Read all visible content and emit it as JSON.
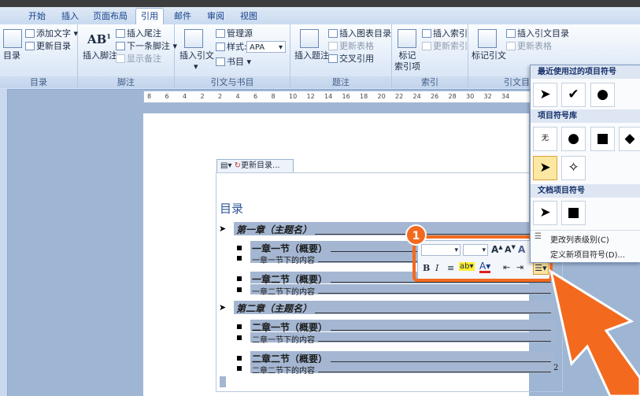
{
  "tabs": [
    "开始",
    "插入",
    "页面布局",
    "引用",
    "邮件",
    "审阅",
    "视图"
  ],
  "active_tab": "引用",
  "ribbon": {
    "toc_group": {
      "label": "目录",
      "toc_button": "目录",
      "add_text": "添加文字",
      "update_toc": "更新目录"
    },
    "footnote_group": {
      "label": "脚注",
      "insert_footnote": "插入脚注",
      "insert_endnote": "插入尾注",
      "next_footnote": "下一条脚注",
      "show_notes": "显示备注"
    },
    "citation_group": {
      "label": "引文与书目",
      "insert_citation": "插入引文",
      "manage_sources": "管理源",
      "style_label": "样式:",
      "style_value": "APA",
      "bibliography": "书目"
    },
    "caption_group": {
      "label": "题注",
      "insert_caption": "插入题注",
      "insert_table_of_figures": "插入图表目录",
      "update_table": "更新表格",
      "cross_reference": "交叉引用"
    },
    "index_group": {
      "label": "索引",
      "mark_entry_line1": "标记",
      "mark_entry_line2": "索引项",
      "insert_index": "插入索引",
      "update_index": "更新索引"
    },
    "toa_group": {
      "label": "引文目",
      "mark_citation": "标记引文",
      "insert_toa": "插入引文目录",
      "update_table": "更新表格"
    }
  },
  "ruler_ticks": [
    "8",
    "6",
    "4",
    "2",
    "2",
    "4",
    "6",
    "8",
    "10",
    "12",
    "14",
    "16",
    "18",
    "20",
    "22",
    "24",
    "26",
    "28",
    "30",
    "32",
    "34"
  ],
  "toc_toolbar": {
    "update_label": "更新目录..."
  },
  "toc": {
    "heading": "目录",
    "entries": [
      {
        "level": 1,
        "text": "第一章（主题名）"
      },
      {
        "level": 2,
        "text": "一章一节（概要）"
      },
      {
        "level": 3,
        "text": "一章一节下的内容"
      },
      {
        "level": 2,
        "text": "一章二节（概要）"
      },
      {
        "level": 3,
        "text": "一章二节下的内容"
      },
      {
        "level": 1,
        "text": "第二章（主题名）"
      },
      {
        "level": 2,
        "text": "二章一节（概要）"
      },
      {
        "level": 3,
        "text": "二章一节下的内容"
      },
      {
        "level": 2,
        "text": "二章二节（概要）"
      },
      {
        "level": 3,
        "text": "二章二节下的内容"
      }
    ],
    "page_number_suffix": "2"
  },
  "mini_toolbar": {
    "bold": "B",
    "italic": "I",
    "font_grow": "A",
    "font_shrink": "A"
  },
  "callout_number": "1",
  "bullet_menu": {
    "recent_header": "最近使用过的项目符号",
    "library_header": "项目符号库",
    "library_none_label": "无",
    "document_header": "文档项目符号",
    "change_level": "更改列表级别(C)",
    "define_new": "定义新项目符号(D)..."
  },
  "colors": {
    "accent_orange": "#f36a1f",
    "ribbon_blue": "#dce8f6",
    "toc_highlight": "#a4b6d1"
  }
}
